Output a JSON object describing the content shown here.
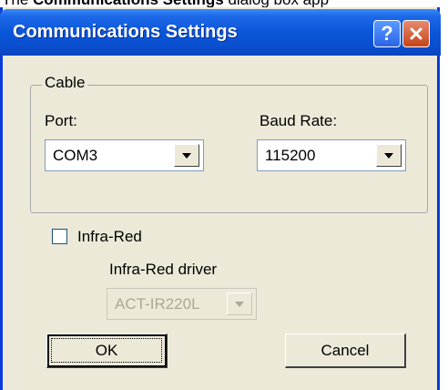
{
  "caption": {
    "prefix": "The",
    "bold": "Communications Settings",
    "suffix": "dialog box app"
  },
  "window": {
    "title": "Communications Settings",
    "help_label": "?",
    "close_icon": "close-icon"
  },
  "cable_group": {
    "legend": "Cable",
    "port_label": "Port:",
    "port_value": "COM3",
    "baud_label": "Baud Rate:",
    "baud_value": "115200"
  },
  "infrared": {
    "checkbox_label": "Infra-Red",
    "checked": false,
    "driver_label": "Infra-Red driver",
    "driver_value": "ACT-IR220L",
    "driver_enabled": false
  },
  "buttons": {
    "ok": "OK",
    "cancel": "Cancel"
  },
  "colors": {
    "titlebar": "#0a56d8",
    "dialog_bg": "#ece9d8",
    "close": "#c64418"
  }
}
